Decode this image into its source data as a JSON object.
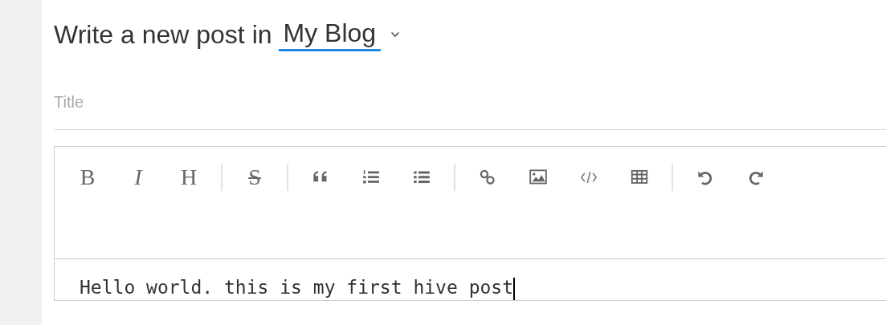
{
  "heading": {
    "prefix": "Write a new post in",
    "blog": "My Blog"
  },
  "title_field": {
    "placeholder": "Title"
  },
  "toolbar": [
    [
      {
        "kind": "bold",
        "label": "B"
      },
      {
        "kind": "italic",
        "label": "I"
      },
      {
        "kind": "heading",
        "label": "H"
      }
    ],
    [
      {
        "kind": "strike",
        "label": "S"
      }
    ],
    [
      {
        "kind": "quote"
      },
      {
        "kind": "ordered-list"
      },
      {
        "kind": "bullet-list"
      }
    ],
    [
      {
        "kind": "link"
      },
      {
        "kind": "image"
      },
      {
        "kind": "code"
      },
      {
        "kind": "table"
      }
    ],
    [
      {
        "kind": "undo"
      },
      {
        "kind": "redo"
      }
    ]
  ],
  "editor": {
    "value": "Hello world. this is my first hive post"
  }
}
